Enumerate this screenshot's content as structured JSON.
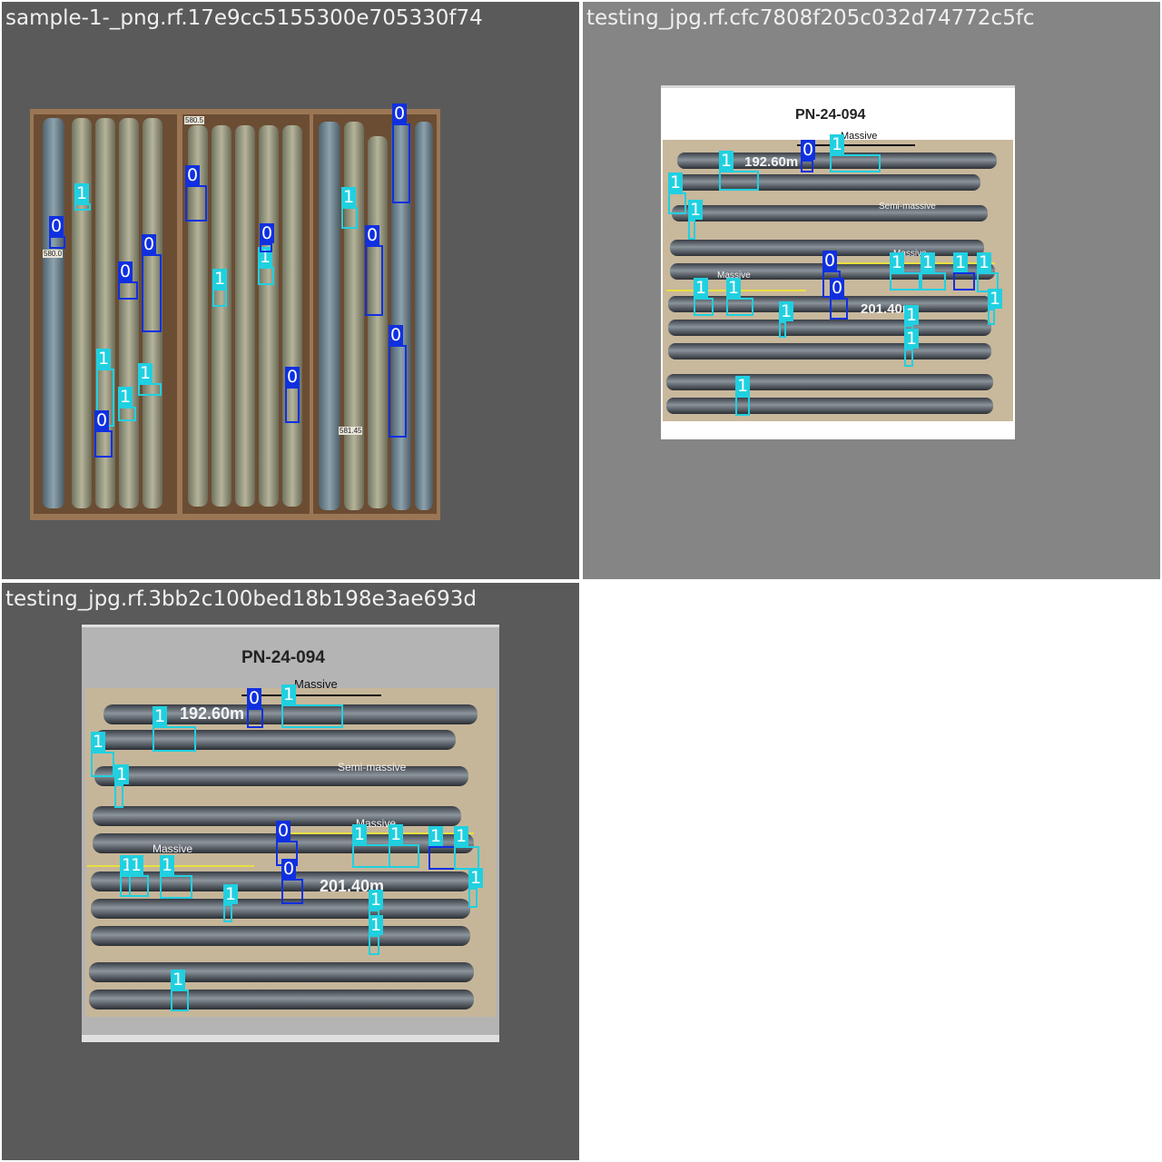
{
  "colors": {
    "class_0": "#1030e0",
    "class_1": "#20d0e0",
    "panel_bg_dark": "#5a5a5a",
    "panel_bg_mid": "#858585",
    "title_text": "#f0f0f0"
  },
  "panels": [
    {
      "title": "sample-1-_png.rf.17e9cc5155300e705330f74",
      "photo_labels": [
        "580.0",
        "580.5",
        "581.45"
      ],
      "detections": [
        {
          "cls": "0"
        },
        {
          "cls": "1"
        },
        {
          "cls": "0"
        },
        {
          "cls": "0"
        },
        {
          "cls": "0"
        },
        {
          "cls": "1"
        },
        {
          "cls": "1"
        },
        {
          "cls": "0"
        },
        {
          "cls": "1"
        },
        {
          "cls": "0"
        },
        {
          "cls": "1"
        },
        {
          "cls": "1"
        },
        {
          "cls": "0"
        },
        {
          "cls": "1"
        },
        {
          "cls": "0"
        },
        {
          "cls": "0"
        },
        {
          "cls": "0"
        },
        {
          "cls": "0"
        },
        {
          "cls": "1"
        }
      ]
    },
    {
      "title": "testing_jpg.rf.cfc7808f205c032d74772c5fc",
      "photo_title": "PN-24-094",
      "photo_labels": [
        "Massive",
        "192.60m",
        "Semi-massive",
        "Massive",
        "Massive",
        "201.40m"
      ],
      "detections": [
        {
          "cls": "0"
        },
        {
          "cls": "1"
        },
        {
          "cls": "1"
        },
        {
          "cls": "1"
        },
        {
          "cls": "1"
        },
        {
          "cls": "0"
        },
        {
          "cls": "1"
        },
        {
          "cls": "1"
        },
        {
          "cls": "1"
        },
        {
          "cls": "1"
        },
        {
          "cls": "1"
        },
        {
          "cls": "1"
        },
        {
          "cls": "0"
        },
        {
          "cls": "1"
        },
        {
          "cls": "1"
        },
        {
          "cls": "1"
        },
        {
          "cls": "1"
        },
        {
          "cls": "1"
        }
      ]
    },
    {
      "title": "testing_jpg.rf.3bb2c100bed18b198e3ae693d",
      "photo_title": "PN-24-094",
      "photo_labels": [
        "Massive",
        "192.60m",
        "Semi-massive",
        "Massive",
        "Massive",
        "201.40m"
      ],
      "detections": [
        {
          "cls": "0"
        },
        {
          "cls": "1"
        },
        {
          "cls": "1"
        },
        {
          "cls": "1"
        },
        {
          "cls": "1"
        },
        {
          "cls": "0"
        },
        {
          "cls": "1"
        },
        {
          "cls": "1"
        },
        {
          "cls": "1"
        },
        {
          "cls": "1"
        },
        {
          "cls": "1"
        },
        {
          "cls": "1"
        },
        {
          "cls": "1"
        },
        {
          "cls": "0"
        },
        {
          "cls": "1"
        },
        {
          "cls": "1"
        },
        {
          "cls": "1"
        },
        {
          "cls": "1"
        },
        {
          "cls": "1"
        }
      ]
    }
  ]
}
